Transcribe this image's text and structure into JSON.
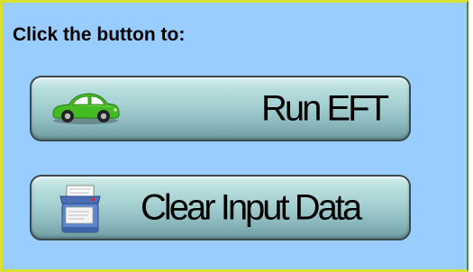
{
  "panel": {
    "heading": "Click the button to:"
  },
  "buttons": {
    "run": {
      "label": "Run EFT",
      "icon": "car-icon"
    },
    "clear": {
      "label": "Clear Input Data",
      "icon": "printer-icon"
    }
  },
  "colors": {
    "panel_background": "#99ccff",
    "panel_border": "#d8e030",
    "car_body": "#44bb22"
  }
}
